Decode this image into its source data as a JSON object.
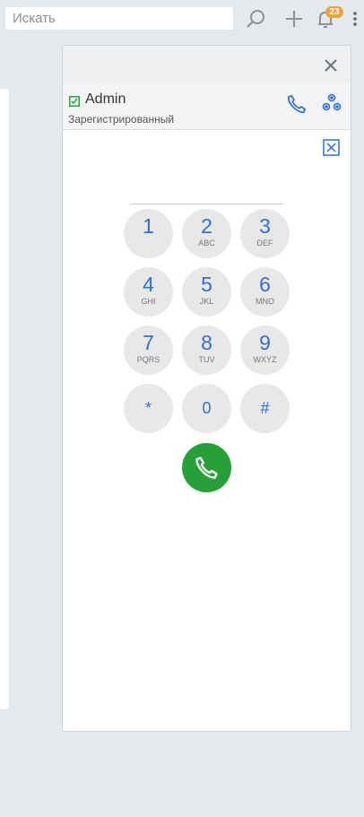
{
  "search": {
    "placeholder": "Искать"
  },
  "header": {
    "notifications_count": "23"
  },
  "account": {
    "name": "Admin",
    "status": "Зарегистрированный"
  },
  "dialpad": {
    "number_value": "",
    "keys": [
      {
        "digit": "1",
        "letters": ""
      },
      {
        "digit": "2",
        "letters": "ABC"
      },
      {
        "digit": "3",
        "letters": "DEF"
      },
      {
        "digit": "4",
        "letters": "GHI"
      },
      {
        "digit": "5",
        "letters": "JKL"
      },
      {
        "digit": "6",
        "letters": "MNO"
      },
      {
        "digit": "7",
        "letters": "PQRS"
      },
      {
        "digit": "8",
        "letters": "TUV"
      },
      {
        "digit": "9",
        "letters": "WXYZ"
      },
      {
        "digit": "*",
        "letters": ""
      },
      {
        "digit": "0",
        "letters": ""
      },
      {
        "digit": "#",
        "letters": ""
      }
    ]
  },
  "colors": {
    "accent_blue": "#2f6fd6",
    "call_green": "#26a137",
    "badge_orange": "#e8a33d"
  },
  "icons": [
    "search-icon",
    "plus-icon",
    "bell-icon",
    "kebab-menu-icon",
    "close-icon",
    "status-icon",
    "phone-icon",
    "settings-icon",
    "clear-icon"
  ]
}
